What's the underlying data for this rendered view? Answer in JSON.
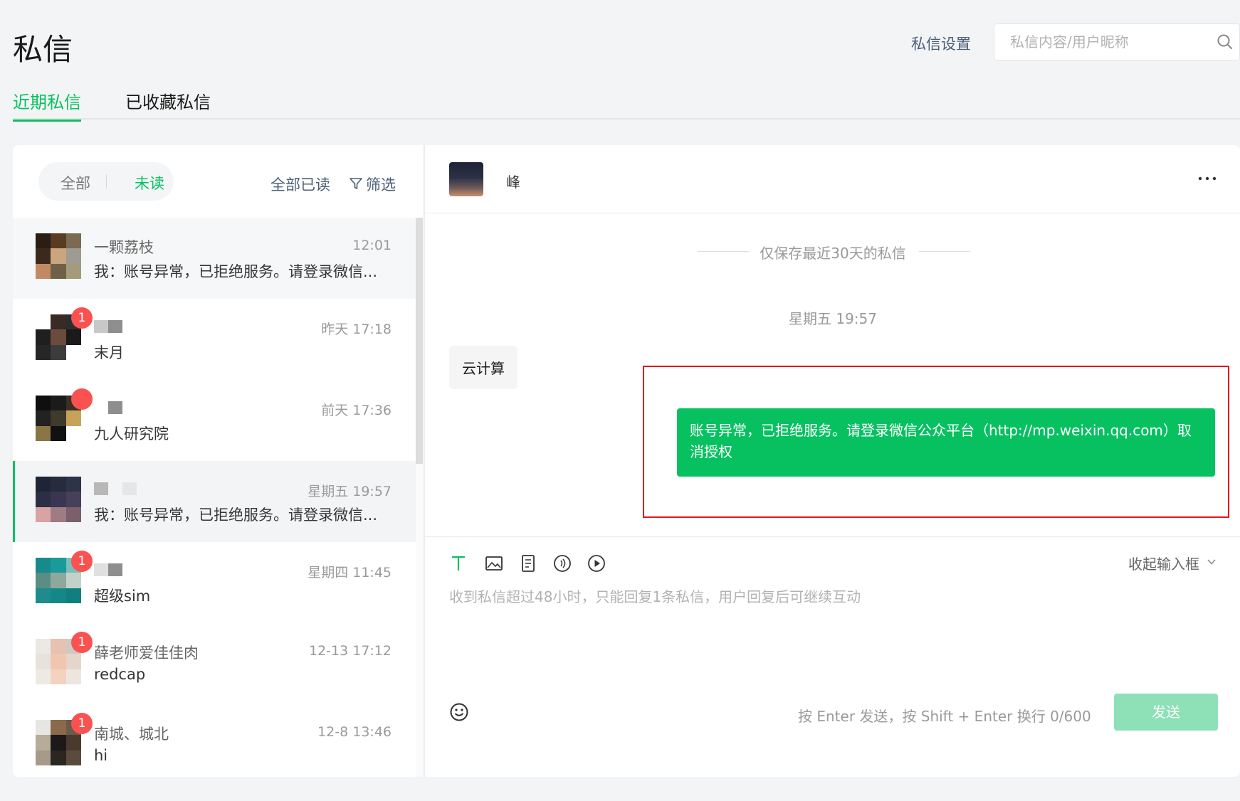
{
  "header": {
    "title": "私信",
    "settings_label": "私信设置",
    "search_placeholder": "私信内容/用户昵称",
    "search_value": ""
  },
  "tabs": [
    {
      "label": "近期私信",
      "active": true
    },
    {
      "label": "已收藏私信",
      "active": false
    }
  ],
  "list_panel": {
    "segment_all": "全部",
    "segment_unread": "未读",
    "mark_all_read": "全部已读",
    "filter_label": "筛选",
    "conversations": [
      {
        "name": "一颗荔枝",
        "time": "12:01",
        "preview": "我：账号异常，已拒绝服务。请登录微信...",
        "badge": ""
      },
      {
        "name": "",
        "time": "昨天 17:18",
        "preview": "末月",
        "badge": "1"
      },
      {
        "name": "",
        "time": "前天 17:36",
        "preview": "九人研究院",
        "badge": ""
      },
      {
        "name": "",
        "time": "星期五 19:57",
        "preview": "我：账号异常，已拒绝服务。请登录微信...",
        "badge": ""
      },
      {
        "name": "",
        "time": "星期四 11:45",
        "preview": "超级sim",
        "badge": "1"
      },
      {
        "name": "薛老师爱佳佳肉",
        "time": "12-13 17:12",
        "preview": "redcap",
        "badge": "1"
      },
      {
        "name": "南城、城北",
        "time": "12-8 13:46",
        "preview": "hi",
        "badge": "1"
      }
    ]
  },
  "chat": {
    "contact_name": "峰",
    "retention_notice": "仅保存最近30天的私信",
    "day_time": "星期五 19:57",
    "incoming_message": "云计算",
    "outgoing_message": "账号异常，已拒绝服务。请登录微信公众平台（http://mp.weixin.qq.com）取消授权",
    "collapse_label": "收起输入框",
    "input_placeholder": "收到私信超过48小时，只能回复1条私信，用户回复后可继续互动",
    "send_hint": "按 Enter 发送，按 Shift + Enter 换行  0/600",
    "send_label": "发送"
  },
  "colors": {
    "accent": "#07c160",
    "badge": "#fa5151",
    "link": "#4a5f7a",
    "highlight_border": "#e4161a"
  }
}
